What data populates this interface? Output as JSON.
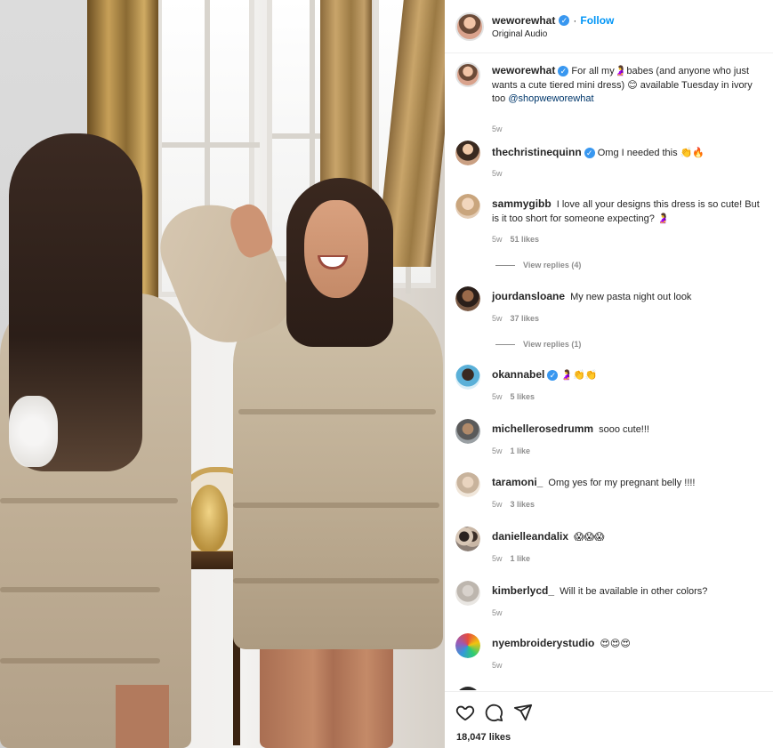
{
  "post": {
    "author": "weworewhat",
    "follow_label": "Follow",
    "separator": "·",
    "audio": "Original Audio"
  },
  "caption": {
    "username": "weworewhat",
    "text_before": "For all my",
    "text_middle": "babes (and anyone who just wants a cute tiered mini dress)",
    "text_after": "available Tuesday in ivory too",
    "mention": "@shopweworewhat",
    "time": "5w"
  },
  "comments": [
    {
      "username": "thechristinequinn",
      "verified": true,
      "text": "Omg I needed this",
      "emoji": "👏🔥",
      "time": "5w",
      "likes": ""
    },
    {
      "username": "sammygibb",
      "verified": false,
      "text": "I love all your designs this dress is so cute! But is it too short for someone expecting?",
      "emoji": "🤰",
      "time": "5w",
      "likes": "51 likes",
      "replies": "View replies (4)"
    },
    {
      "username": "jourdansloane",
      "verified": false,
      "text": "My new pasta night out look",
      "emoji": "",
      "time": "5w",
      "likes": "37 likes",
      "replies": "View replies (1)"
    },
    {
      "username": "okannabel",
      "verified": true,
      "text": "",
      "emoji": "🤰👏👏",
      "time": "5w",
      "likes": "5 likes"
    },
    {
      "username": "michellerosedrumm",
      "verified": false,
      "text": "sooo cute!!!",
      "emoji": "",
      "time": "5w",
      "likes": "1 like"
    },
    {
      "username": "taramoni_",
      "verified": false,
      "text": "Omg yes for my pregnant belly !!!!",
      "emoji": "",
      "time": "5w",
      "likes": "3 likes"
    },
    {
      "username": "danielleandalix",
      "verified": false,
      "text": "",
      "emoji": "😱😱😱",
      "time": "5w",
      "likes": "1 like"
    },
    {
      "username": "kimberlycd_",
      "verified": false,
      "text": "Will it be available in other colors?",
      "emoji": "",
      "time": "5w",
      "likes": ""
    },
    {
      "username": "nyembroiderystudio",
      "verified": false,
      "text": "",
      "emoji": "😍😍😍",
      "time": "5w",
      "likes": ""
    }
  ],
  "actions": {
    "like_icon": "heart-icon",
    "comment_icon": "comment-icon",
    "share_icon": "share-icon",
    "likes_count": "18,047 likes"
  },
  "colors": {
    "link_blue": "#0095f6",
    "verified_blue": "#3897f0",
    "muted": "#8e8e8e",
    "text": "#262626"
  }
}
